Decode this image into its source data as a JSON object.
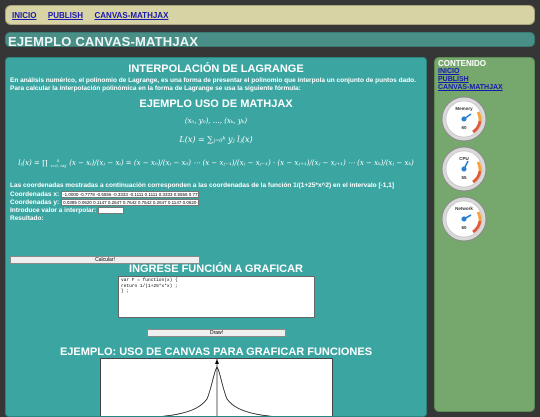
{
  "nav": {
    "items": [
      "INICIO",
      "PUBLISH",
      "CANVAS-MATHJAX"
    ]
  },
  "page": {
    "title": "EJEMPLO CANVAS-MATHJAX"
  },
  "main": {
    "lagrange_heading": "INTERPOLACIÓN DE LAGRANGE",
    "intro": "En análisis numérico, el polinomio de Lagrange, es una forma de presentar el polinomio que interpola un conjunto de puntos dado. Para calcular la interpolación polinómica en la forma de Lagrange se usa la siguiente fórmula:",
    "mathjax_heading": "EJEMPLO USO DE MATHJAX",
    "formula_points": "(x₀, y₀), …, (xₖ, yₖ)",
    "formula_L": "L(x) = ∑ⱼ₌₀ᵏ yⱼ lⱼ(x)",
    "formula_l_lhs": "lⱼ(x) = ∏",
    "formula_l_sub": "i=0, i≠j",
    "formula_l_sup": "k",
    "formula_l_rhs": "(x − xᵢ)/(xⱼ − xᵢ) = (x − x₀)/(xⱼ − x₀) ⋯ (x − xⱼ₋₁)/(xⱼ − xⱼ₋₁) · (x − xⱼ₊₁)/(xⱼ − xⱼ₊₁) ⋯ (x − xₖ)/(xⱼ − xₖ)",
    "coords_note": "Las coordenadas mostradas a continuación corresponden a las coordenadas de la función 1/(1+25*x^2) en el intervalo [-1,1]",
    "coord_x_label": "Coordenadas x:",
    "coord_x_value": "-1.0000 -0.7778 -0.5556 -0.3333 -0.1111 0.1111 0.3333 0.5556 0.7778 1.0000",
    "coord_y_label": "Coordenadas y:",
    "coord_y_value": "0.0385 0.0620 0.1147 0.2647 0.7642 0.7642 0.2647 0.1147 0.0620 0.0385",
    "interp_label": "Introduce valor a interpolar:",
    "interp_value": "",
    "result_label": "Resultado:",
    "calc_button": "Calcular!",
    "graph_heading": "INGRESE FUNCIÓN A GRAFICAR",
    "function_code": "var F = function(x) {\nreturn 1/(1+25*x*x) ;\n} ;",
    "draw_button": "Draw!",
    "canvas_heading": "EJEMPLO: USO DE CANVAS PARA GRAFICAR FUNCIONES"
  },
  "sidebar": {
    "title": "CONTENIDO",
    "links": [
      "INICIO",
      "PUBLISH",
      "CANVAS-MATHJAX"
    ],
    "gauges": [
      {
        "label": "Memory",
        "value": "60",
        "level": 0.55
      },
      {
        "label": "CPU",
        "value": "55",
        "level": 0.5
      },
      {
        "label": "Network",
        "value": "60",
        "level": 0.55
      }
    ]
  },
  "colors": {
    "main_bg": "#3ba5a2",
    "side_bg": "#76a86d",
    "nav_bg": "#d8d3a4",
    "page_bg": "#363636"
  }
}
